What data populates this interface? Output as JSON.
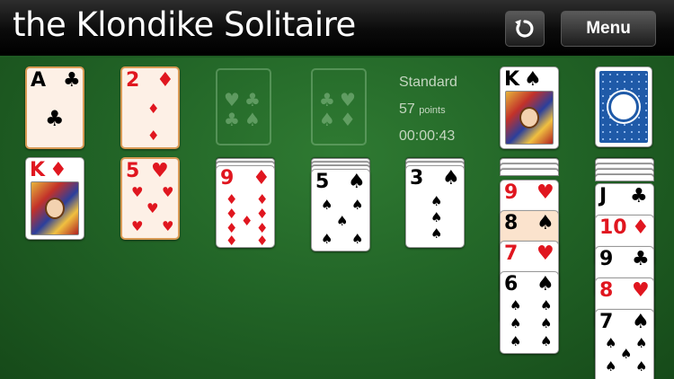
{
  "header": {
    "title": "the Klondike Solitaire",
    "menu_label": "Menu",
    "undo_icon": "undo-icon"
  },
  "stats": {
    "mode": "Standard",
    "points_value": "57",
    "points_unit": "points",
    "timer": "00:00:43"
  },
  "foundations": [
    {
      "rank": "A",
      "suit": "♣",
      "color": "black"
    },
    {
      "rank": "2",
      "suit": "♦",
      "color": "red"
    },
    {
      "empty_suit_icons": "♥♣♠♦"
    },
    {
      "empty_suit_icons": "♥♣♠♦"
    }
  ],
  "waste": {
    "rank": "K",
    "suit": "♠",
    "color": "black"
  },
  "stock": {
    "card_back_icon": "card-back-icon"
  },
  "tableau": [
    {
      "hidden": 0,
      "cards": [
        {
          "rank": "K",
          "suit": "♦",
          "color": "red"
        }
      ]
    },
    {
      "hidden": 0,
      "cards": [
        {
          "rank": "5",
          "suit": "♥",
          "color": "red"
        }
      ]
    },
    {
      "hidden": 2,
      "cards": [
        {
          "rank": "9",
          "suit": "♦",
          "color": "red"
        }
      ]
    },
    {
      "hidden": 3,
      "cards": [
        {
          "rank": "5",
          "suit": "♠",
          "color": "black"
        }
      ]
    },
    {
      "hidden": 2,
      "cards": [
        {
          "rank": "3",
          "suit": "♠",
          "color": "black"
        }
      ]
    },
    {
      "hidden": 3,
      "cards": [
        {
          "rank": "9",
          "suit": "♥",
          "color": "red"
        },
        {
          "rank": "8",
          "suit": "♠",
          "color": "black"
        },
        {
          "rank": "7",
          "suit": "♥",
          "color": "red"
        },
        {
          "rank": "6",
          "suit": "♠",
          "color": "black"
        }
      ]
    },
    {
      "hidden": 4,
      "cards": [
        {
          "rank": "J",
          "suit": "♣",
          "color": "black"
        },
        {
          "rank": "10",
          "suit": "♦",
          "color": "red"
        },
        {
          "rank": "9",
          "suit": "♣",
          "color": "black"
        },
        {
          "rank": "8",
          "suit": "♥",
          "color": "red"
        },
        {
          "rank": "7",
          "suit": "♠",
          "color": "black"
        }
      ]
    }
  ],
  "colors": {
    "felt": "#226527",
    "red_suit": "#e0161f",
    "black_suit": "#000000",
    "highlight": "#fbe3cd"
  }
}
